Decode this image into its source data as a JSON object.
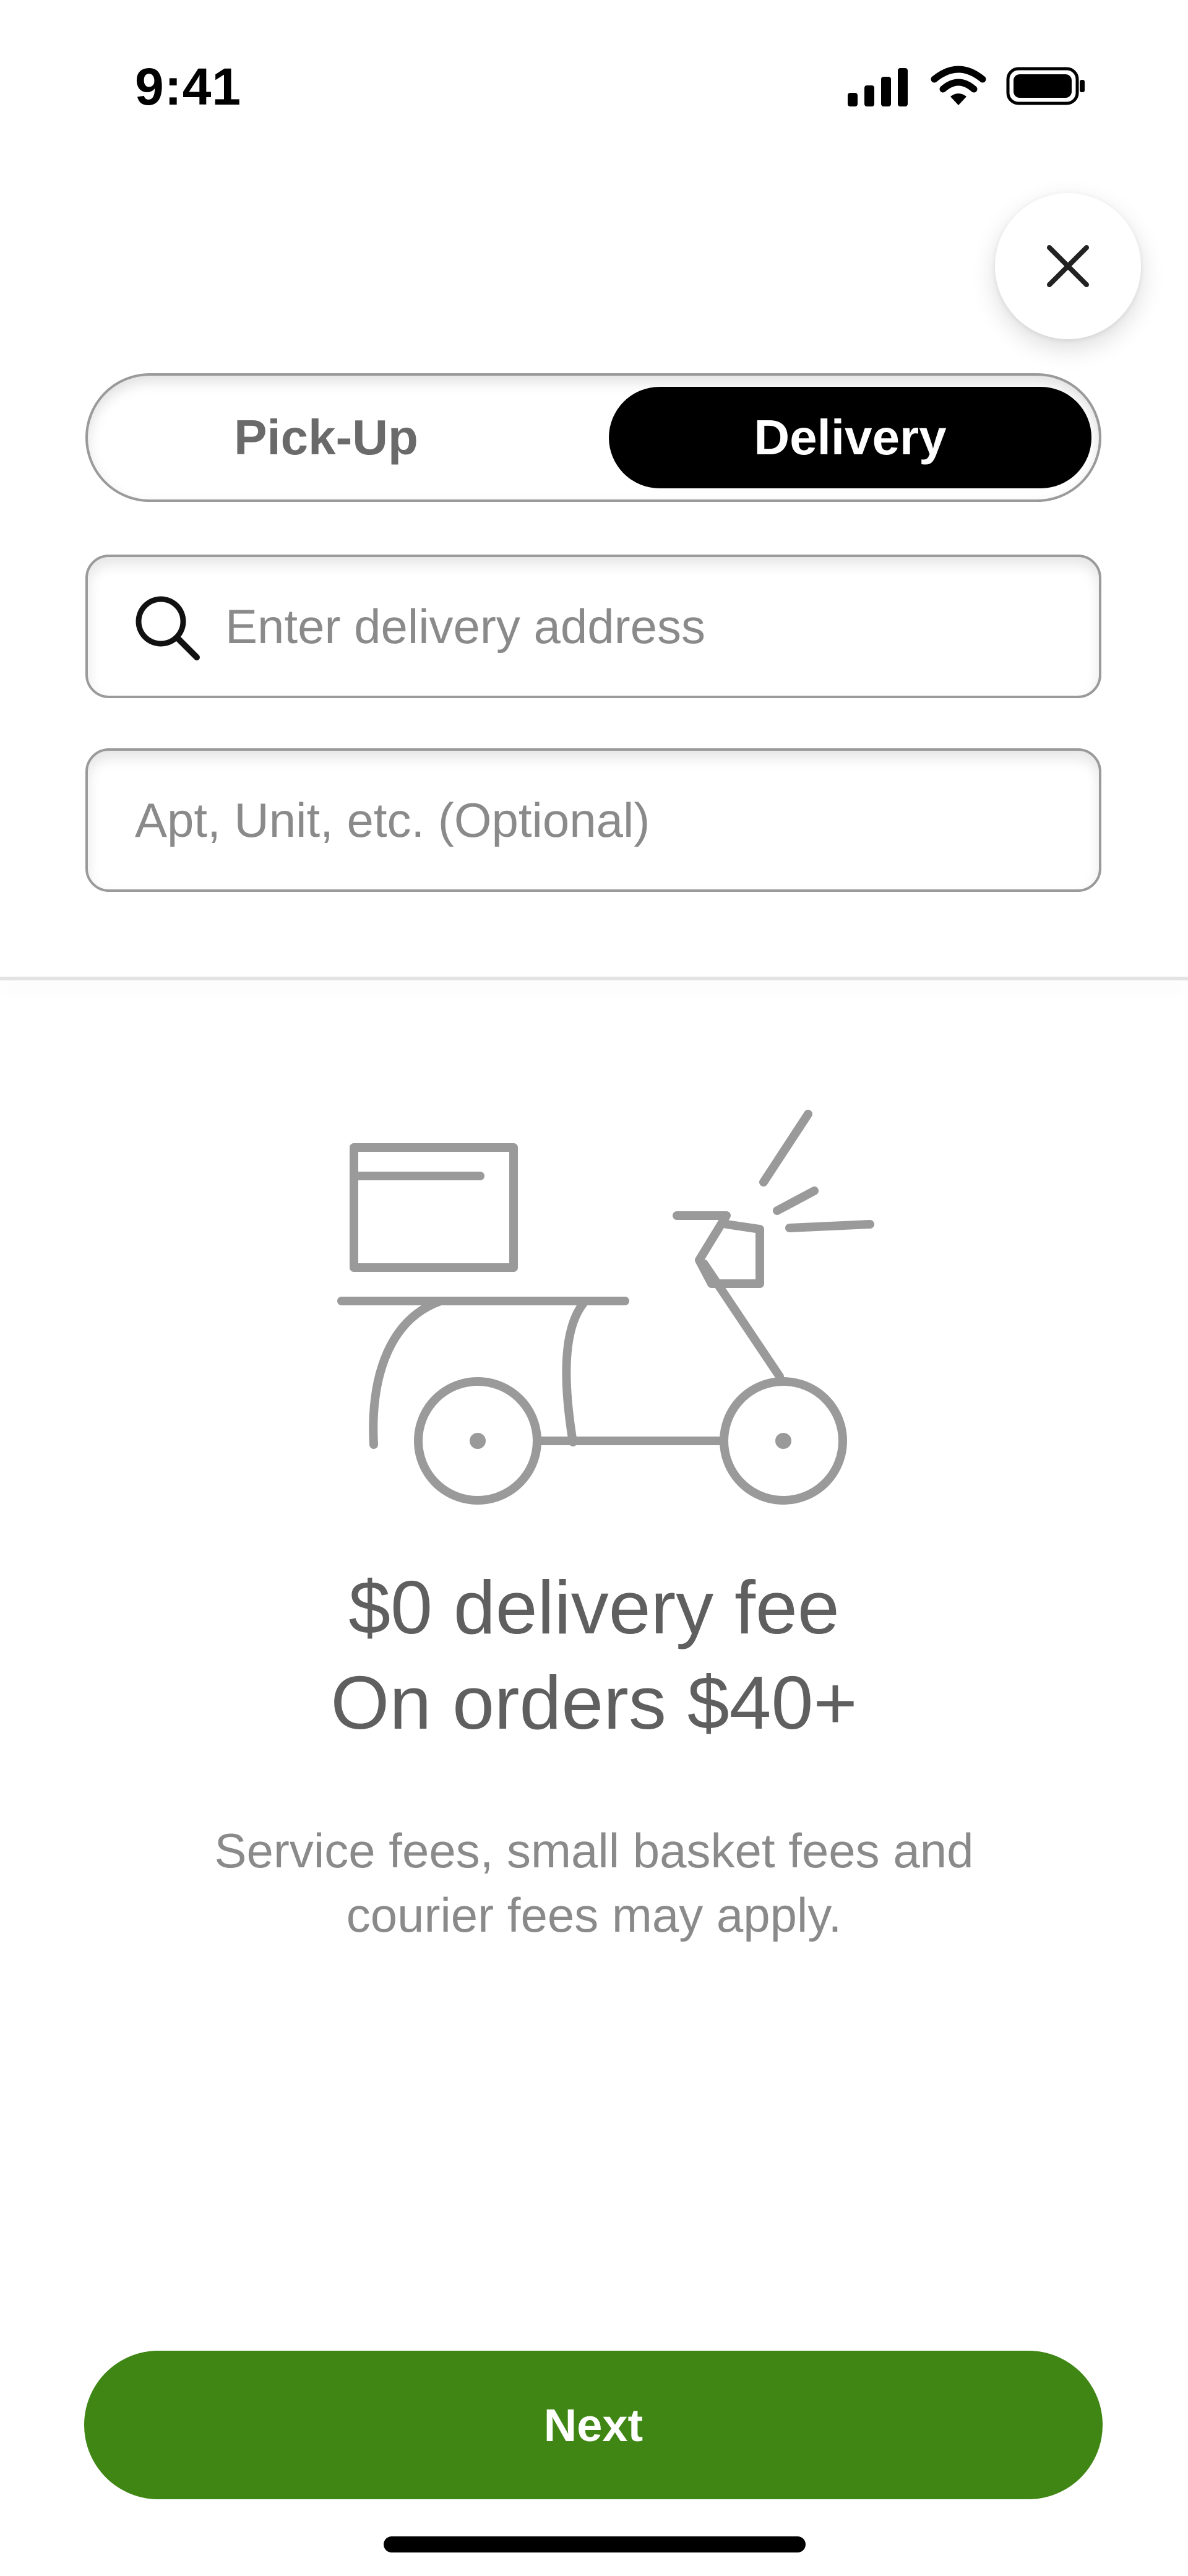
{
  "status_bar": {
    "time": "9:41"
  },
  "order_mode": {
    "options": [
      {
        "label": "Pick-Up",
        "selected": false
      },
      {
        "label": "Delivery",
        "selected": true
      }
    ]
  },
  "address_field": {
    "placeholder": "Enter delivery address",
    "value": ""
  },
  "apt_field": {
    "placeholder": "Apt, Unit, etc. (Optional)",
    "value": ""
  },
  "promo": {
    "title_line1": "$0 delivery fee",
    "title_line2": "On orders $40+",
    "subtitle_line1": "Service fees, small basket fees and",
    "subtitle_line2": "courier fees may apply."
  },
  "next_button": {
    "label": "Next"
  },
  "icons": {
    "close": "close-icon",
    "search": "search-icon",
    "illustration": "delivery-scooter-icon"
  },
  "colors": {
    "accent_green": "#3f8614",
    "selected_segment": "#000000"
  }
}
